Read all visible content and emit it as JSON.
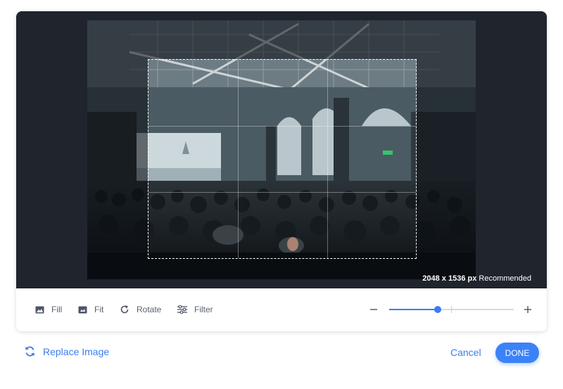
{
  "editor": {
    "resolution": "2048 x 1536 px",
    "resolution_note": "Recommended"
  },
  "toolbar": {
    "fill_label": "Fill",
    "fit_label": "Fit",
    "rotate_label": "Rotate",
    "filter_label": "Filter"
  },
  "zoom": {
    "level": 0.39,
    "icons": {
      "minus": "minus-icon",
      "plus": "plus-icon"
    }
  },
  "actions": {
    "replace_label": "Replace Image",
    "cancel_label": "Cancel",
    "done_label": "DONE"
  },
  "colors": {
    "accent": "#3b82f6",
    "stage_bg": "#1f242d"
  }
}
